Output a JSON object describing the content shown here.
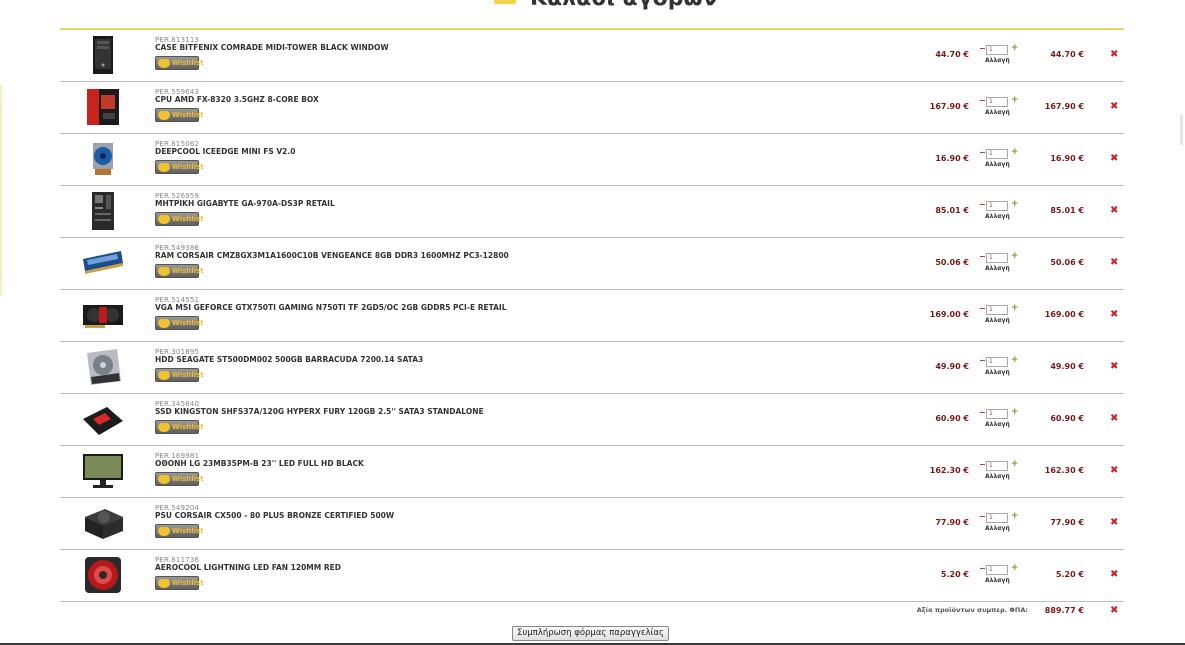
{
  "header": {
    "title": "Καλάθι αγορών"
  },
  "items": [
    {
      "code": "PER.813113",
      "name": "CASE BITFENIX COMRADE MIDI-TOWER BLACK WINDOW",
      "price": "44.70 €",
      "qty": "1",
      "total": "44.70 €",
      "img": "case"
    },
    {
      "code": "PER.559643",
      "name": "CPU AMD FX-8320 3.5GHZ 8-CORE BOX",
      "price": "167.90 €",
      "qty": "1",
      "total": "167.90 €",
      "img": "cpu"
    },
    {
      "code": "PER.815062",
      "name": "DEEPCOOL ICEEDGE MINI FS V2.0",
      "price": "16.90 €",
      "qty": "1",
      "total": "16.90 €",
      "img": "cooler"
    },
    {
      "code": "PER.526959",
      "name": "ΜΗΤΡΙΚΗ GIGABYTE GA-970A-DS3P RETAIL",
      "price": "85.01 €",
      "qty": "1",
      "total": "85.01 €",
      "img": "motherboard"
    },
    {
      "code": "PER.549386",
      "name": "RAM CORSAIR CMZ8GX3M1A1600C10B VENGEANCE 8GB DDR3 1600MHZ PC3-12800",
      "price": "50.06 €",
      "qty": "1",
      "total": "50.06 €",
      "img": "ram"
    },
    {
      "code": "PER.514551",
      "name": "VGA MSI GEFORCE GTX750TI GAMING N750TI TF 2GD5/OC 2GB GDDR5 PCI-E RETAIL",
      "price": "169.00 €",
      "qty": "1",
      "total": "169.00 €",
      "img": "gpu"
    },
    {
      "code": "PER.301895",
      "name": "HDD SEAGATE ST500DM002 500GB BARRACUDA 7200.14 SATA3",
      "price": "49.90 €",
      "qty": "1",
      "total": "49.90 €",
      "img": "hdd"
    },
    {
      "code": "PER.345840",
      "name": "SSD KINGSTON SHFS37A/120G HYPERX FURY 120GB 2.5'' SATA3 STANDALONE",
      "price": "60.90 €",
      "qty": "1",
      "total": "60.90 €",
      "img": "ssd"
    },
    {
      "code": "PER.169981",
      "name": "ΟΘΟΝΗ LG 23MB35PM-B 23'' LED FULL HD BLACK",
      "price": "162.30 €",
      "qty": "1",
      "total": "162.30 €",
      "img": "monitor"
    },
    {
      "code": "PER.549204",
      "name": "PSU CORSAIR CX500 - 80 PLUS BRONZE CERTIFIED 500W",
      "price": "77.90 €",
      "qty": "1",
      "total": "77.90 €",
      "img": "psu"
    },
    {
      "code": "PER.811736",
      "name": "AEROCOOL LIGHTNING LED FAN 120MM RED",
      "price": "5.20 €",
      "qty": "1",
      "total": "5.20 €",
      "img": "fan"
    }
  ],
  "labels": {
    "wishlist": "Wishlist",
    "update": "Αλλαγή",
    "minus": "−",
    "plus": "+",
    "remove": "✖"
  },
  "summary": {
    "label": "Αξία προϊόντων συμπερ. ΦΠΑ:",
    "value": "889.77 €"
  },
  "actions": {
    "submit_label": "Συμπλήρωση φόρμας παραγγελίας"
  }
}
